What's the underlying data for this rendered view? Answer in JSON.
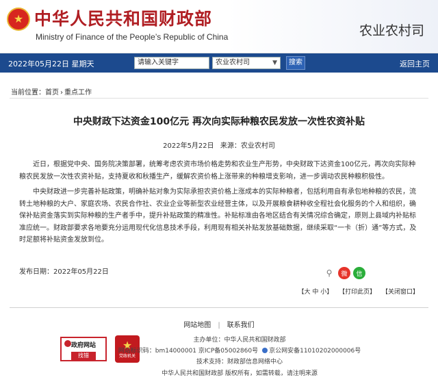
{
  "header": {
    "site_name_cn": "中华人民共和国财政部",
    "site_name_en": "Ministry of Finance of the People’s Republic of China",
    "department": "农业农村司",
    "emblem_icon": "national-emblem-icon"
  },
  "navbar": {
    "date": "2022年05月22日  星期天",
    "search_placeholder": "请输入关键字",
    "search_scope": "农业农村司",
    "search_button": "搜索",
    "home_link": "返回主页",
    "bg_color": "#1c4a8e"
  },
  "breadcrumb": {
    "prefix": "当前位置：",
    "home": "首页",
    "separator": "›",
    "current": "重点工作"
  },
  "article": {
    "title": "中央财政下达资金100亿元 再次向实际种粮农民发放一次性农资补贴",
    "date": "2022年5月22日",
    "source": "来源：农业农村司",
    "paragraphs": [
      "近日，根据党中央、国务院决策部署，统筹考虑农资市场价格走势和农业生产形势，中央财政下达资金100亿元，再次向实际种粮农民发放一次性农资补贴，支持夏收和秋播生产，缓解农资价格上涨带来的种粮增支影响，进一步调动农民种粮积极性。",
      "中央财政进一步完善补贴政策，明确补贴对象为实际承担农资价格上涨成本的实际种粮者，包括利用自有承包地种粮的农民，流转土地种粮的大户、家庭农场、农民合作社、农业企业等新型农业经营主体，以及开展粮食耕种收全程社会化服务的个人和组织，确保补贴资金落实到实际种粮的生产者手中，提升补贴政策的精准性。补贴标准由各地区结合有关情况综合确定，原则上县域内补贴标准应统一。财政部要求各地要充分运用现代化信息技术手段，利用现有相关补贴发放基础数据，继续采取“一卡（折）通”等方式，及时足额将补贴资金发放到位。"
    ],
    "publish_date": "发布日期：2022年05月22日"
  },
  "share": {
    "icons": [
      "share-icon",
      "weibo-icon",
      "wechat-icon"
    ]
  },
  "tools": {
    "font_size": "【大 中 小】",
    "print": "【打印此页】",
    "close": "【关闭窗口】"
  },
  "footer": {
    "sitemap": "网站地图",
    "contact": "联系我们",
    "sponsor": "主办单位：中华人民共和国财政部",
    "site_id": "网站标识码：bm14000001",
    "icp": "京ICP备05002860号",
    "police": "京公网安备11010202000006号",
    "tech_support": "技术支持：财政部信息网络中心",
    "copyright": "中华人民共和国财政部 版权所有，如需转载，请注明来源",
    "gov_badge_top": "政府网站",
    "gov_badge_bottom": "找错",
    "party_badge": "党政机关"
  }
}
